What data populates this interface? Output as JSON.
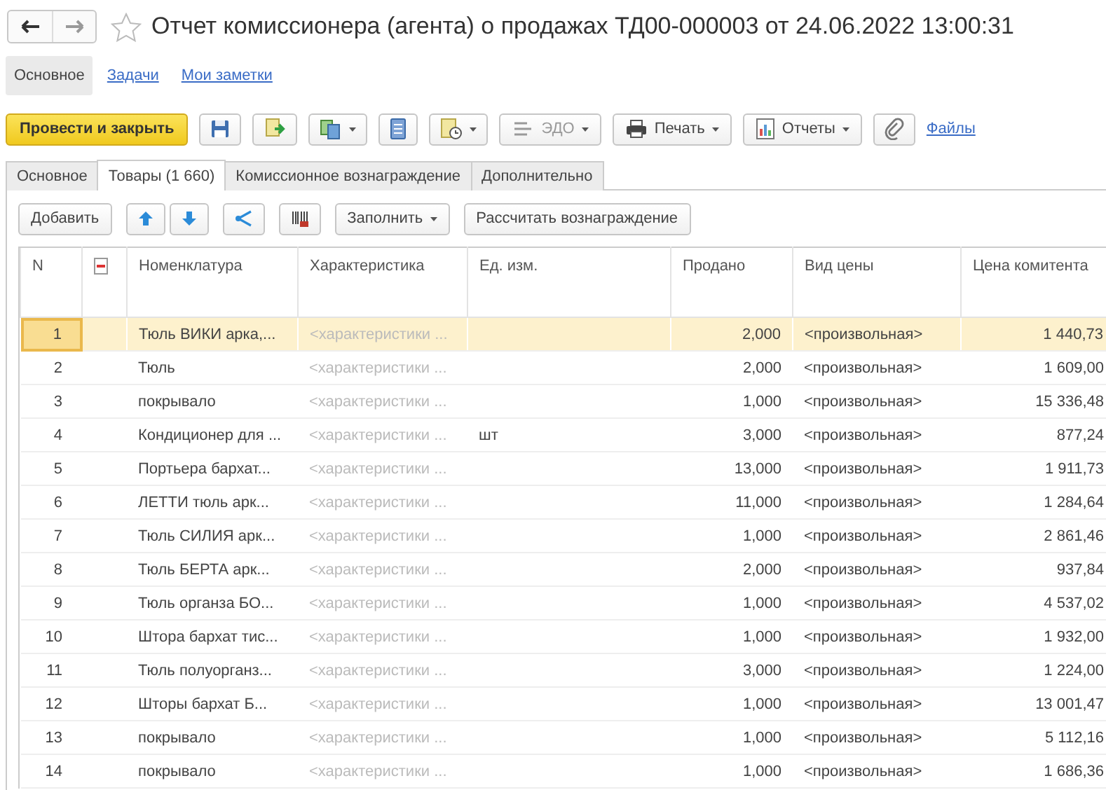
{
  "window": {
    "title": "Отчет комиссионера (агента) о продажах ТД00-000003 от 24.06.2022 13:00:31",
    "favorite": false
  },
  "section_tabs": [
    {
      "label": "Основное",
      "selected": true
    },
    {
      "label": "Задачи",
      "selected": false
    },
    {
      "label": "Мои заметки",
      "selected": false
    }
  ],
  "toolbar": [
    {
      "kind": "primary",
      "label": "Провести и закрыть"
    },
    {
      "kind": "icon"
    },
    {
      "kind": "icon"
    },
    {
      "kind": "icon-menu"
    },
    {
      "kind": "icon"
    },
    {
      "kind": "icon-menu"
    },
    {
      "kind": "menu",
      "label": "ЭДО",
      "disabled": true
    },
    {
      "kind": "menu",
      "label": "Печать",
      "disabled": false
    },
    {
      "kind": "menu",
      "label": "Отчеты",
      "disabled": false
    },
    {
      "kind": "icon"
    },
    {
      "kind": "link",
      "label": "Файлы"
    }
  ],
  "tabs": [
    {
      "label": "Основное",
      "selected": false
    },
    {
      "label": "Товары (1 660)",
      "selected": true
    },
    {
      "label": "Комиссионное вознаграждение",
      "selected": false
    },
    {
      "label": "Дополнительно",
      "selected": false
    }
  ],
  "table_toolbar": [
    {
      "kind": "text",
      "label": "Добавить"
    },
    {
      "kind": "updown"
    },
    {
      "kind": "icon"
    },
    {
      "kind": "icon"
    },
    {
      "kind": "menu",
      "label": "Заполнить"
    },
    {
      "kind": "text",
      "label": "Рассчитать вознаграждение"
    }
  ],
  "table": {
    "columns": [
      "N",
      "",
      "Номенклатура",
      "Характеристика",
      "Ед. изм.",
      "Продано",
      "Вид цены",
      "Цена комитента"
    ],
    "rows": [
      {
        "n": "1",
        "nomenclature": "Тюль ВИКИ арка,...",
        "characteristic": "<характеристики ...",
        "unit": "",
        "sold": "2,000",
        "price_type": "<произвольная>",
        "price": "1 440,73",
        "selected": true
      },
      {
        "n": "2",
        "nomenclature": "Тюль",
        "characteristic": "<характеристики ...",
        "unit": "",
        "sold": "2,000",
        "price_type": "<произвольная>",
        "price": "1 609,00",
        "selected": false
      },
      {
        "n": "3",
        "nomenclature": "покрывало",
        "characteristic": "<характеристики ...",
        "unit": "",
        "sold": "1,000",
        "price_type": "<произвольная>",
        "price": "15 336,48",
        "selected": false
      },
      {
        "n": "4",
        "nomenclature": "Кондиционер для ...",
        "characteristic": "<характеристики ...",
        "unit": "шт",
        "sold": "3,000",
        "price_type": "<произвольная>",
        "price": "877,24",
        "selected": false
      },
      {
        "n": "5",
        "nomenclature": "Портьера бархат...",
        "characteristic": "<характеристики ...",
        "unit": "",
        "sold": "13,000",
        "price_type": "<произвольная>",
        "price": "1 911,73",
        "selected": false
      },
      {
        "n": "6",
        "nomenclature": "ЛЕТТИ тюль арк...",
        "characteristic": "<характеристики ...",
        "unit": "",
        "sold": "11,000",
        "price_type": "<произвольная>",
        "price": "1 284,64",
        "selected": false
      },
      {
        "n": "7",
        "nomenclature": "Тюль СИЛИЯ арк...",
        "characteristic": "<характеристики ...",
        "unit": "",
        "sold": "1,000",
        "price_type": "<произвольная>",
        "price": "2 861,46",
        "selected": false
      },
      {
        "n": "8",
        "nomenclature": "Тюль БЕРТА арк...",
        "characteristic": "<характеристики ...",
        "unit": "",
        "sold": "2,000",
        "price_type": "<произвольная>",
        "price": "937,84",
        "selected": false
      },
      {
        "n": "9",
        "nomenclature": "Тюль органза БО...",
        "characteristic": "<характеристики ...",
        "unit": "",
        "sold": "1,000",
        "price_type": "<произвольная>",
        "price": "4 537,02",
        "selected": false
      },
      {
        "n": "10",
        "nomenclature": "Штора бархат тис...",
        "characteristic": "<характеристики ...",
        "unit": "",
        "sold": "1,000",
        "price_type": "<произвольная>",
        "price": "1 932,00",
        "selected": false
      },
      {
        "n": "11",
        "nomenclature": "Тюль полуорганз...",
        "characteristic": "<характеристики ...",
        "unit": "",
        "sold": "3,000",
        "price_type": "<произвольная>",
        "price": "1 224,00",
        "selected": false
      },
      {
        "n": "12",
        "nomenclature": "Шторы бархат Б...",
        "characteristic": "<характеристики ...",
        "unit": "",
        "sold": "1,000",
        "price_type": "<произвольная>",
        "price": "13 001,47",
        "selected": false
      },
      {
        "n": "13",
        "nomenclature": "покрывало",
        "characteristic": "<характеристики ...",
        "unit": "",
        "sold": "1,000",
        "price_type": "<произвольная>",
        "price": "5 112,16",
        "selected": false
      },
      {
        "n": "14",
        "nomenclature": "покрывало",
        "characteristic": "<характеристики ...",
        "unit": "",
        "sold": "1,000",
        "price_type": "<произвольная>",
        "price": "1 686,36",
        "selected": false
      }
    ]
  }
}
